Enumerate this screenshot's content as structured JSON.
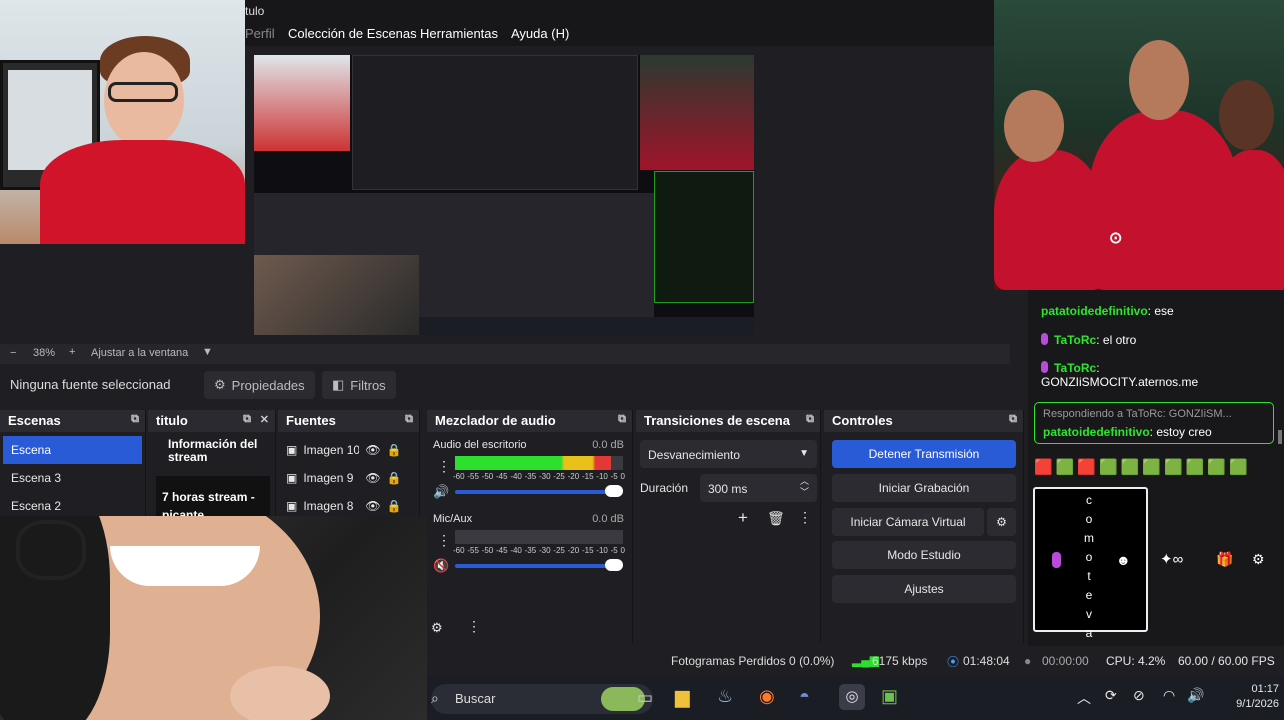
{
  "window": {
    "title_fragment": "tulo"
  },
  "menu": {
    "items": [
      "Perfil",
      "Colección de Escenas",
      "Herramientas",
      "Ayuda (H)"
    ]
  },
  "zoom": {
    "minus": "−",
    "value": "38%",
    "plus": "+",
    "fit_label": "Ajustar a la ventana"
  },
  "sourcebar": {
    "status": "Ninguna fuente seleccionad",
    "properties": "Propiedades",
    "filters": "Filtros"
  },
  "scenes": {
    "title": "Escenas",
    "items": [
      "Escena",
      "Escena 3",
      "Escena 2"
    ]
  },
  "titulo": {
    "title": "titulo",
    "info_label": "Información del stream",
    "stream_text": "7 horas stream -picante"
  },
  "sources": {
    "title": "Fuentes",
    "items": [
      "Imagen 10",
      "Imagen 9",
      "Imagen 8"
    ]
  },
  "mixer": {
    "title": "Mezclador de audio",
    "channels": [
      {
        "name": "Audio del escritorio",
        "db": "0.0 dB",
        "level": 0.93
      },
      {
        "name": "Mic/Aux",
        "db": "0.0 dB",
        "level": 0.0
      }
    ],
    "scale": [
      "-60",
      "-55",
      "-50",
      "-45",
      "-40",
      "-35",
      "-30",
      "-25",
      "-20",
      "-15",
      "-10",
      "-5",
      "0"
    ]
  },
  "transitions": {
    "title": "Transiciones de escena",
    "selected": "Desvanecimiento",
    "duration_label": "Duración",
    "duration_value": "300 ms"
  },
  "controls": {
    "title": "Controles",
    "stop_stream": "Detener Transmisión",
    "start_record": "Iniciar Grabación",
    "virtual_cam": "Iniciar Cámara Virtual",
    "studio_mode": "Modo Estudio",
    "settings": "Ajustes"
  },
  "status": {
    "dropped": "Fotogramas Perdidos 0 (0.0%)",
    "bitrate": "6175 kbps",
    "live_time": "01:48:04",
    "rec_time": "00:00:00",
    "cpu": "CPU: 4.2%",
    "fps": "60.00 / 60.00 FPS"
  },
  "chat": {
    "messages": [
      {
        "user": "patatoidedefinitivo",
        "text": ": ese",
        "badge": false
      },
      {
        "user": "TaToRc",
        "text": ": el otro",
        "badge": true
      },
      {
        "user": "TaToRc",
        "text": ":",
        "badge": true,
        "second_line": "GONZIiSMOCITY.aternos.me"
      }
    ],
    "reply": {
      "header": "Respondiendo a TaToRc: GONZIiSM...",
      "user": "patatoidedefinitivo",
      "text": ": estoy creo"
    },
    "vertical_text": [
      "c",
      "o",
      "m",
      "o",
      "t",
      "e",
      "v",
      "a"
    ]
  },
  "taskbar": {
    "search": "Buscar",
    "time": "01:17",
    "date": "9/1/2026"
  },
  "colors": {
    "accent": "#2a5bd7",
    "chat_green": "#2fe42f",
    "meter_green": "#2ee02e",
    "meter_yellow": "#e8c21a",
    "meter_red": "#e23838"
  }
}
